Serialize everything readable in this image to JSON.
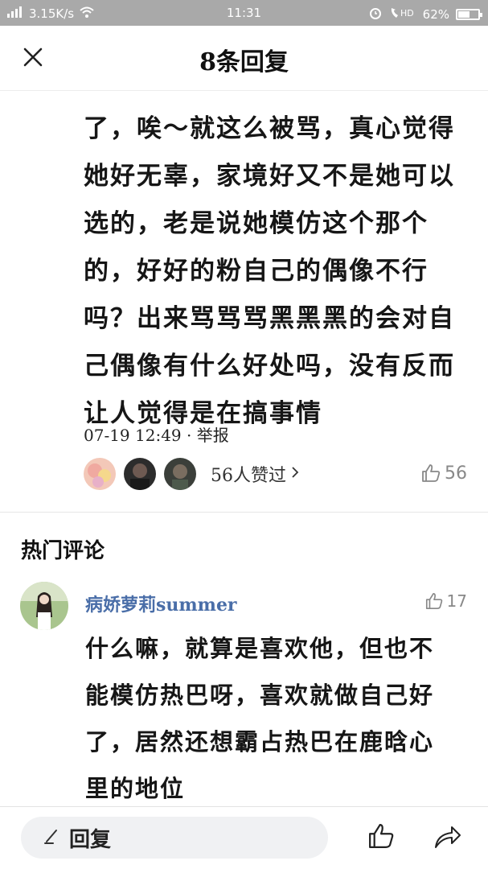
{
  "status_bar": {
    "network_speed": "3.15K/s",
    "time": "11:31",
    "battery": "62%",
    "battery_level": 0.62,
    "network_type": "HD"
  },
  "header": {
    "title": "8条回复"
  },
  "main_comment": {
    "lines": [
      "了，唉～就这么被骂，真心觉得",
      "她好无辜，家境好又不是她可以",
      "选的，老是说她模仿这个那个",
      "的，好好的粉自己的偶像不行",
      "吗？出来骂骂骂黑黑黑的会对自",
      "己偶像有什么好处吗，没有反而",
      "让人觉得是在搞事情"
    ],
    "date": "07-19 12:49",
    "separator": "·",
    "report": "举报",
    "likers_text": "56人赞过",
    "likes": "56"
  },
  "hot_section": {
    "title": "热门评论"
  },
  "hot_comment": {
    "username": "病娇萝莉summer",
    "likes": "17",
    "lines": [
      "什么嘛，就算是喜欢他，但也不",
      "能模仿热巴呀，喜欢就做自己好",
      "了，居然还想霸占热巴在鹿晗心",
      "里的地位"
    ]
  },
  "bottom_bar": {
    "reply_label": "回复"
  },
  "colors": {
    "status_bar": "#a9a9a9",
    "username": "#4a6ea8",
    "reply_box": "#f0f1f3"
  }
}
